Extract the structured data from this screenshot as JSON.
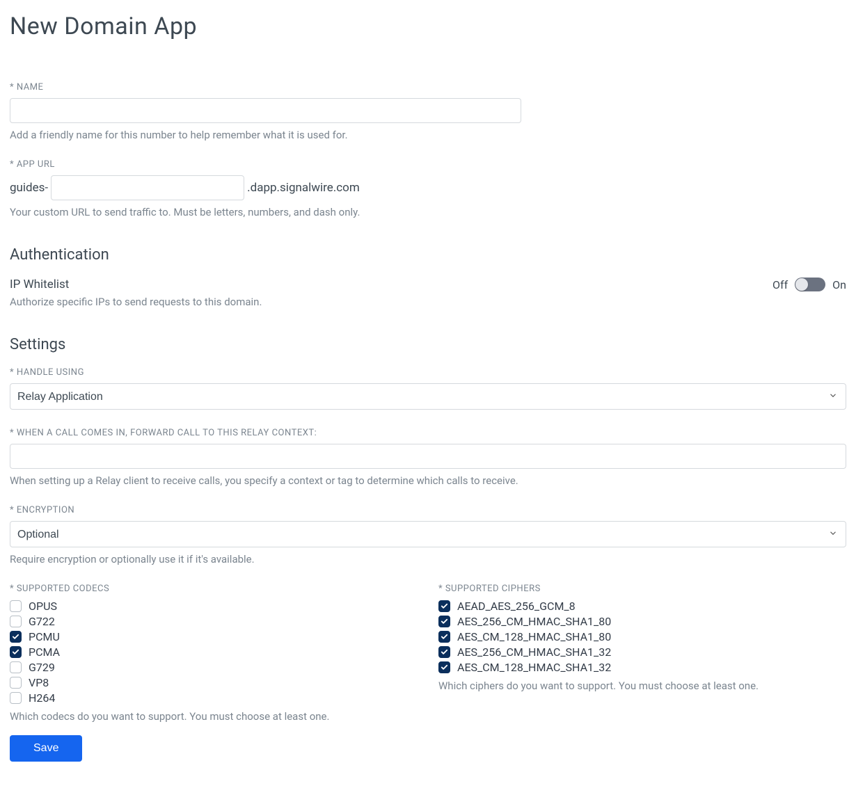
{
  "page": {
    "title": "New Domain App"
  },
  "name_field": {
    "label": "* NAME",
    "value": "",
    "help": "Add a friendly name for this number to help remember what it is used for."
  },
  "app_url": {
    "label": "* APP URL",
    "prefix": "guides-",
    "value": "",
    "suffix": ".dapp.signalwire.com",
    "help": "Your custom URL to send traffic to. Must be letters, numbers, and dash only."
  },
  "auth": {
    "section_title": "Authentication",
    "ip_whitelist_title": "IP Whitelist",
    "ip_whitelist_help": "Authorize specific IPs to send requests to this domain.",
    "toggle_off": "Off",
    "toggle_on": "On",
    "toggle_state": false
  },
  "settings": {
    "section_title": "Settings",
    "handle_using": {
      "label": "* HANDLE USING",
      "value": "Relay Application"
    },
    "relay_context": {
      "label": "* WHEN A CALL COMES IN, FORWARD CALL TO THIS RELAY CONTEXT:",
      "value": "",
      "help": "When setting up a Relay client to receive calls, you specify a context or tag to determine which calls to receive."
    },
    "encryption": {
      "label": "* ENCRYPTION",
      "value": "Optional",
      "help": "Require encryption or optionally use it if it's available."
    },
    "codecs": {
      "label": "* SUPPORTED CODECS",
      "items": [
        {
          "label": "OPUS",
          "checked": false
        },
        {
          "label": "G722",
          "checked": false
        },
        {
          "label": "PCMU",
          "checked": true
        },
        {
          "label": "PCMA",
          "checked": true
        },
        {
          "label": "G729",
          "checked": false
        },
        {
          "label": "VP8",
          "checked": false
        },
        {
          "label": "H264",
          "checked": false
        }
      ],
      "help": "Which codecs do you want to support. You must choose at least one."
    },
    "ciphers": {
      "label": "* SUPPORTED CIPHERS",
      "items": [
        {
          "label": "AEAD_AES_256_GCM_8",
          "checked": true
        },
        {
          "label": "AES_256_CM_HMAC_SHA1_80",
          "checked": true
        },
        {
          "label": "AES_CM_128_HMAC_SHA1_80",
          "checked": true
        },
        {
          "label": "AES_256_CM_HMAC_SHA1_32",
          "checked": true
        },
        {
          "label": "AES_CM_128_HMAC_SHA1_32",
          "checked": true
        }
      ],
      "help": "Which ciphers do you want to support. You must choose at least one."
    }
  },
  "actions": {
    "save": "Save"
  }
}
